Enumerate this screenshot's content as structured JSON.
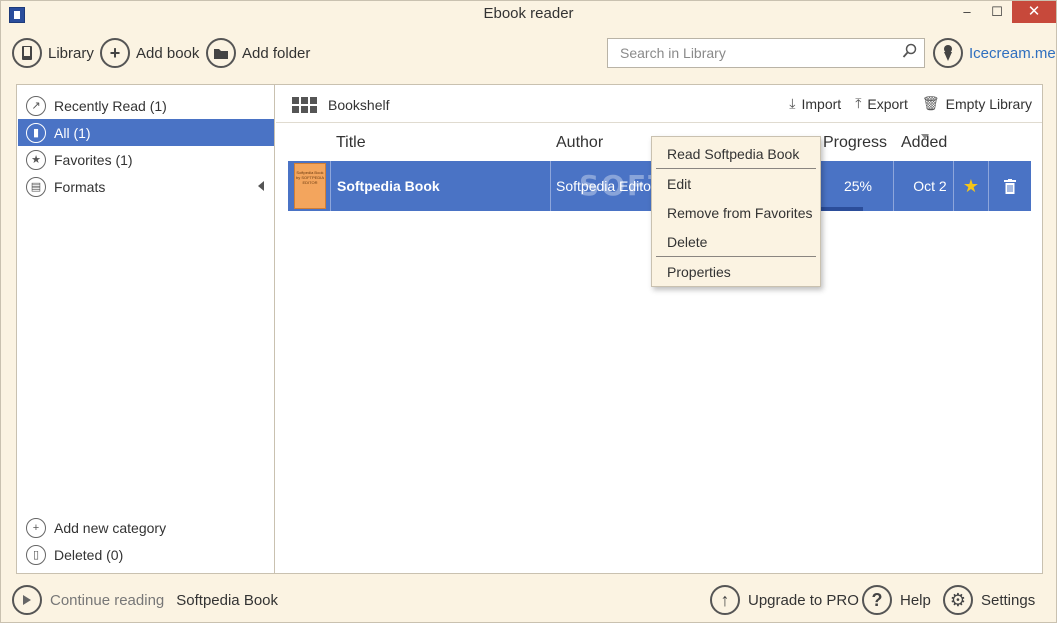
{
  "window": {
    "title": "Ebook reader",
    "controls": {
      "minimize": "–",
      "maximize": "☐",
      "close": "✕"
    }
  },
  "toolbar": {
    "library_label": "Library",
    "add_book_label": "Add book",
    "add_folder_label": "Add folder",
    "search_placeholder": "Search in Library",
    "brand_link": "Icecream.me"
  },
  "sidebar": {
    "items": [
      {
        "label": "Recently Read (1)",
        "icon": "share-icon"
      },
      {
        "label": "All (1)",
        "icon": "book-icon"
      },
      {
        "label": "Favorites (1)",
        "icon": "star-icon"
      },
      {
        "label": "Formats",
        "icon": "file-icon"
      }
    ],
    "bottom_items": [
      {
        "label": "Add new category",
        "icon": "plus-icon"
      },
      {
        "label": "Deleted (0)",
        "icon": "trash-icon"
      }
    ]
  },
  "content": {
    "view_label": "Bookshelf",
    "actions": {
      "import": "Import",
      "export": "Export",
      "empty": "Empty Library"
    },
    "columns": {
      "title": "Title",
      "author": "Author",
      "progress": "Progress",
      "added": "Added"
    },
    "book": {
      "title": "Softpedia Book",
      "author": "Softpedia Editor",
      "progress": "25%",
      "progress_value": 0.25,
      "added": "Oct 2",
      "thumb_title": "Softpedia Book",
      "thumb_sub": "by SOFTPEDIA EDITOR"
    }
  },
  "context_menu": {
    "read": "Read Softpedia Book",
    "edit": "Edit",
    "remove_fav": "Remove from Favorites",
    "delete": "Delete",
    "properties": "Properties"
  },
  "watermark": "SOFTPEDIA",
  "statusbar": {
    "continue_label": "Continue reading",
    "continue_book": "Softpedia Book",
    "upgrade": "Upgrade to PRO",
    "help": "Help",
    "settings": "Settings"
  },
  "colors": {
    "accent": "#4a73c5",
    "background": "#fbf3e2",
    "star": "#f5c518"
  }
}
